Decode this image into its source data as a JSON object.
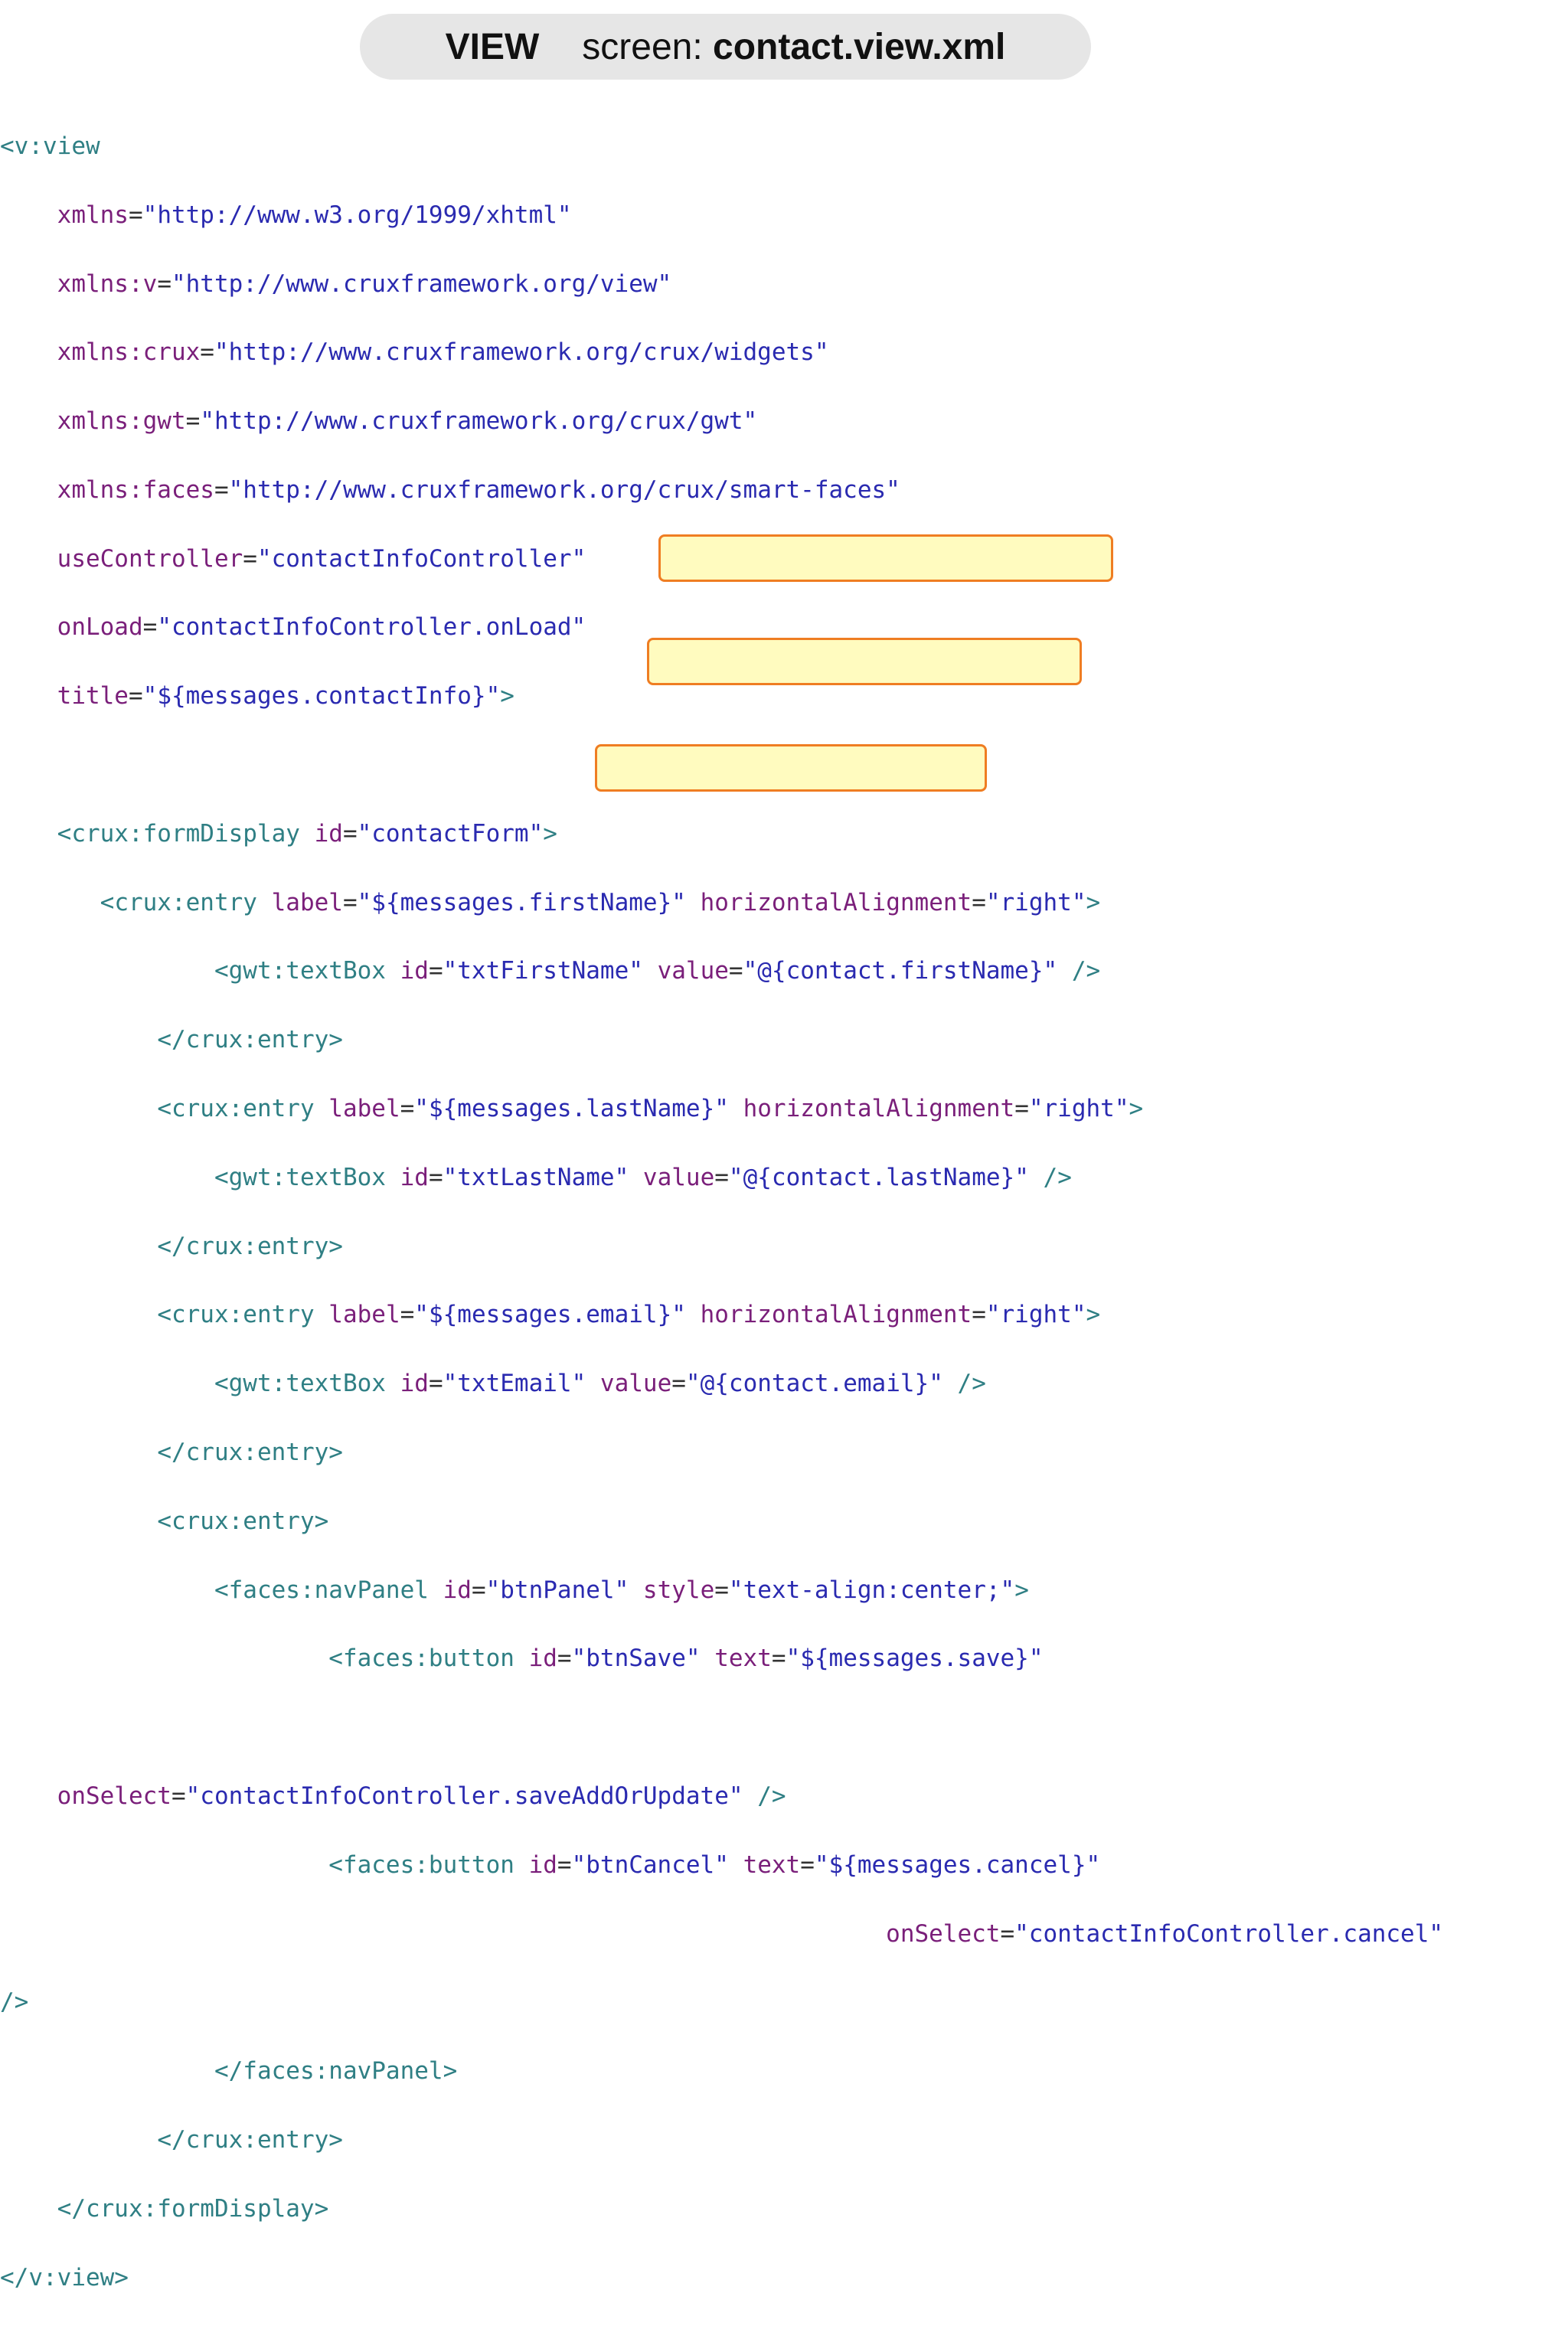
{
  "header": {
    "view": "VIEW",
    "screen": "screen:",
    "file": "contact.view.xml"
  },
  "code": {
    "l01": {
      "tag": "<v:view"
    },
    "l02": {
      "attr": "xmlns",
      "eq": "=",
      "val": "\"http://www.w3.org/1999/xhtml\""
    },
    "l03": {
      "attr": "xmlns:v",
      "eq": "=",
      "val": "\"http://www.cruxframework.org/view\""
    },
    "l04": {
      "attr": "xmlns:crux",
      "eq": "=",
      "val": "\"http://www.cruxframework.org/crux/widgets\""
    },
    "l05": {
      "attr": "xmlns:gwt",
      "eq": "=",
      "val": "\"http://www.cruxframework.org/crux/gwt\""
    },
    "l06": {
      "attr": "xmlns:faces",
      "eq": "=",
      "val": "\"http://www.cruxframework.org/crux/smart-faces\""
    },
    "l07": {
      "attr": "useController",
      "eq": "=",
      "val": "\"contactInfoController\""
    },
    "l08": {
      "attr": "onLoad",
      "eq": "=",
      "val": "\"contactInfoController.onLoad\""
    },
    "l09": {
      "attr": "title",
      "eq": "=",
      "val": "\"${messages.contactInfo}\"",
      "close": ">"
    },
    "l11": {
      "tag": "<crux:formDisplay",
      "attr": "id",
      "eq": "=",
      "val": "\"contactForm\"",
      "close": ">"
    },
    "l12": {
      "tag": "<crux:entry",
      "attr1": "label",
      "eq1": "=",
      "val1": "\"${messages.firstName}\"",
      "attr2": "horizontalAlignment",
      "eq2": "=",
      "val2": "\"right\"",
      "close": ">"
    },
    "l13": {
      "tag": "<gwt:textBox",
      "attr1": "id",
      "eq1": "=",
      "val1": "\"txtFirstName\"",
      "attr2": "value",
      "eq2": "=",
      "val2": "\"@{contact.firstName}\"",
      "close": "/>"
    },
    "l14": {
      "tag": "</crux:entry>"
    },
    "l15": {
      "tag": "<crux:entry",
      "attr1": "label",
      "eq1": "=",
      "val1": "\"${messages.lastName}\"",
      "attr2": "horizontalAlignment",
      "eq2": "=",
      "val2": "\"right\"",
      "close": ">"
    },
    "l16": {
      "tag": "<gwt:textBox",
      "attr1": "id",
      "eq1": "=",
      "val1": "\"txtLastName\"",
      "attr2": "value",
      "eq2": "=",
      "val2": "\"@{contact.lastName}\"",
      "close": "/>"
    },
    "l17": {
      "tag": "</crux:entry>"
    },
    "l18": {
      "tag": "<crux:entry",
      "attr1": "label",
      "eq1": "=",
      "val1": "\"${messages.email}\"",
      "attr2": "horizontalAlignment",
      "eq2": "=",
      "val2": "\"right\"",
      "close": ">"
    },
    "l19": {
      "tag": "<gwt:textBox",
      "attr1": "id",
      "eq1": "=",
      "val1": "\"txtEmail\"",
      "attr2": "value",
      "eq2": "=",
      "val2": "\"@{contact.email}\"",
      "close": "/>"
    },
    "l20": {
      "tag": "</crux:entry>"
    },
    "l21": {
      "tag": "<crux:entry>"
    },
    "l22": {
      "tag": "<faces:navPanel",
      "attr1": "id",
      "eq1": "=",
      "val1": "\"btnPanel\"",
      "attr2": "style",
      "eq2": "=",
      "val2": "\"text-align:center;\"",
      "close": ">"
    },
    "l23": {
      "tag": "<faces:button",
      "attr1": "id",
      "eq1": "=",
      "val1": "\"btnSave\"",
      "attr2": "text",
      "eq2": "=",
      "val2": "\"${messages.save}\""
    },
    "l25": {
      "attr": "onSelect",
      "eq": "=",
      "val": "\"contactInfoController.saveAddOrUpdate\"",
      "close": "/>"
    },
    "l26": {
      "tag": "<faces:button",
      "attr1": "id",
      "eq1": "=",
      "val1": "\"btnCancel\"",
      "attr2": "text",
      "eq2": "=",
      "val2": "\"${messages.cancel}\""
    },
    "l27": {
      "attr": "onSelect",
      "eq": "=",
      "val": "\"contactInfoController.cancel\""
    },
    "l28": {
      "tag": "/>"
    },
    "l29": {
      "tag": "</faces:navPanel>"
    },
    "l30": {
      "tag": "</crux:entry>"
    },
    "l31": {
      "tag": "</crux:formDisplay>"
    },
    "l32": {
      "tag": "</v:view>"
    }
  },
  "colors": {
    "tag": "#2f7f84",
    "attribute": "#7a1f7a",
    "value": "#2a2ab0",
    "highlight_fill": "#fffaaa",
    "highlight_border": "#ef7d22"
  }
}
